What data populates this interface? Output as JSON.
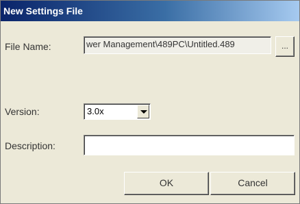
{
  "window": {
    "title": "New Settings File"
  },
  "fields": {
    "file_name_label": "File Name:",
    "file_name_value": "wer Management\\489PC\\Untitled.489",
    "browse_label": "...",
    "version_label": "Version:",
    "version_value": "3.0x",
    "description_label": "Description:",
    "description_value": ""
  },
  "buttons": {
    "ok_label": "OK",
    "cancel_label": "Cancel"
  },
  "colors": {
    "titlebar_start": "#0a246a",
    "titlebar_end": "#a6caf0",
    "dialog_bg": "#ece9d8"
  }
}
